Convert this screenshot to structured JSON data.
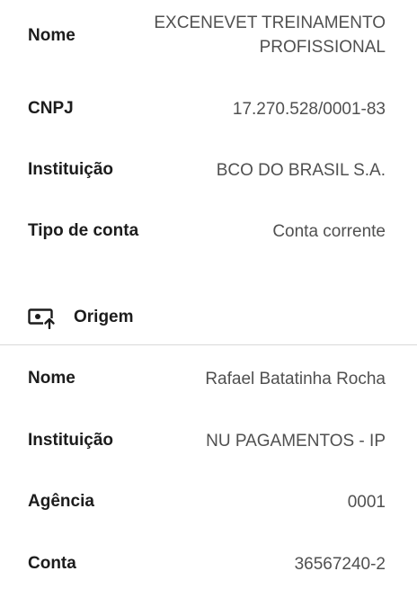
{
  "destino": {
    "nome_label": "Nome",
    "nome_value_line1": "EXCENEVET TREINAMENTO",
    "nome_value_line2": "PROFISSIONAL",
    "cnpj_label": "CNPJ",
    "cnpj_value": "17.270.528/0001-83",
    "instituicao_label": "Instituição",
    "instituicao_value": "BCO DO BRASIL S.A.",
    "tipo_label": "Tipo de conta",
    "tipo_value": "Conta corrente"
  },
  "origem": {
    "title": "Origem",
    "icon": "transfer-out-icon",
    "nome_label": "Nome",
    "nome_value": "Rafael Batatinha Rocha",
    "instituicao_label": "Instituição",
    "instituicao_value": "NU PAGAMENTOS - IP",
    "agencia_label": "Agência",
    "agencia_value": "0001",
    "conta_label": "Conta",
    "conta_value": "36567240-2"
  }
}
